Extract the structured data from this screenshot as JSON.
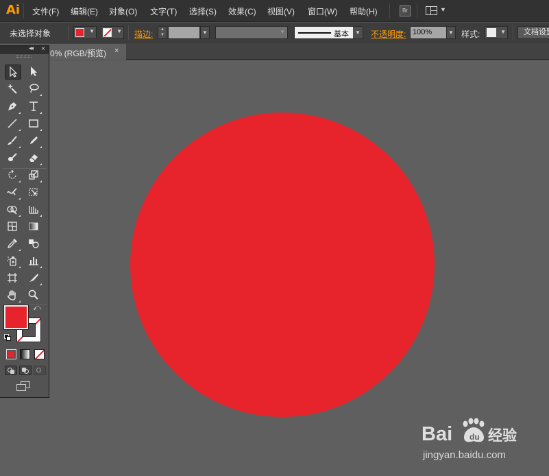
{
  "app": {
    "logo": "Ai"
  },
  "menu": {
    "items": [
      "文件(F)",
      "编辑(E)",
      "对象(O)",
      "文字(T)",
      "选择(S)",
      "效果(C)",
      "视图(V)",
      "窗口(W)",
      "帮助(H)"
    ],
    "bridge_label": "Br"
  },
  "control_bar": {
    "selection_status": "未选择对象",
    "stroke_label": "描边:",
    "brush_label": "基本",
    "opacity_label": "不透明度:",
    "opacity_value": "100%",
    "style_label": "样式:",
    "doc_settings_label": "文档设置"
  },
  "document_tab": {
    "label": "0% (RGB/预览)",
    "close": "×"
  },
  "colors": {
    "accent": "#ff9a00",
    "fill": "#e7232b",
    "canvas": "#5f5f5f",
    "ui_dark": "#323232"
  },
  "tools_panel": {
    "collapse": "◂◂",
    "close": "×",
    "tools": [
      "selection-tool",
      "direct-selection-tool",
      "magic-wand-tool",
      "lasso-tool",
      "pen-tool",
      "type-tool",
      "line-segment-tool",
      "rectangle-tool",
      "paintbrush-tool",
      "pencil-tool",
      "blob-brush-tool",
      "eraser-tool",
      "rotate-tool",
      "scale-tool",
      "warp-tool",
      "free-transform-tool",
      "shape-builder-tool",
      "perspective-grid-tool",
      "mesh-tool",
      "gradient-tool",
      "eyedropper-tool",
      "blend-tool",
      "symbol-sprayer-tool",
      "column-graph-tool",
      "artboard-tool",
      "slice-tool",
      "hand-tool",
      "zoom-tool"
    ]
  },
  "watermark": {
    "url": "jingyan.baidu.com"
  }
}
